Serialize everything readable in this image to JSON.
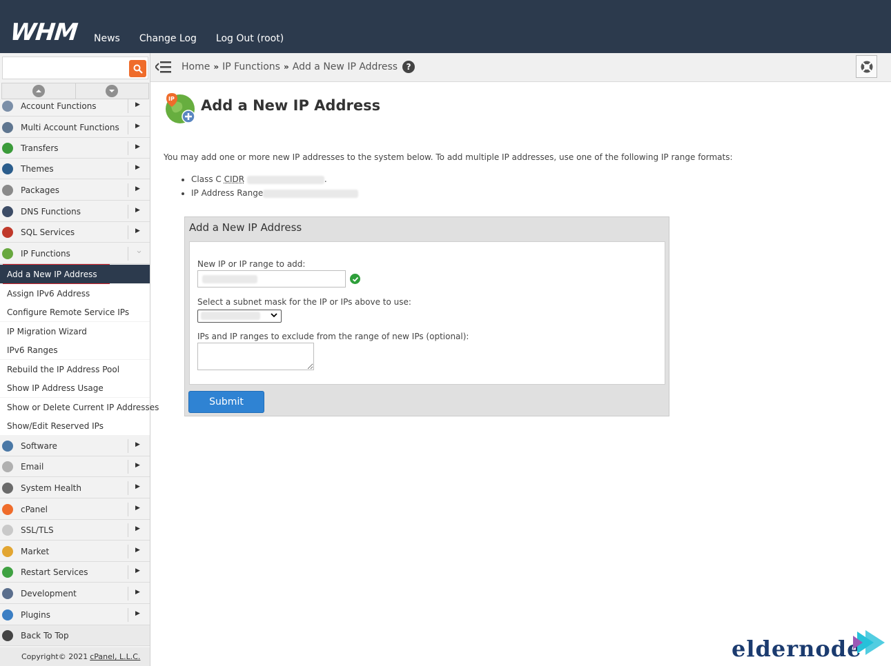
{
  "topbar": {
    "logo": "WHM",
    "nav": [
      "News",
      "Change Log",
      "Log Out (root)"
    ]
  },
  "sidebar": {
    "search_value": "",
    "items_top": [
      {
        "label": "Account Functions",
        "icon": "account-icon",
        "color": "#7b8fa8"
      },
      {
        "label": "Multi Account Functions",
        "icon": "multi-account-icon",
        "color": "#5f7690"
      },
      {
        "label": "Transfers",
        "icon": "transfers-icon",
        "color": "#3b9b3a"
      },
      {
        "label": "Themes",
        "icon": "themes-icon",
        "color": "#2b5d8c"
      },
      {
        "label": "Packages",
        "icon": "packages-icon",
        "color": "#8a8a8a"
      },
      {
        "label": "DNS Functions",
        "icon": "dns-icon",
        "color": "#3c4c66"
      },
      {
        "label": "SQL Services",
        "icon": "sql-icon",
        "color": "#c0392b"
      },
      {
        "label": "IP Functions",
        "icon": "ip-icon",
        "color": "#68a83f"
      }
    ],
    "sub_items": [
      "Add a New IP Address",
      "Assign IPv6 Address",
      "Configure Remote Service IPs",
      "IP Migration Wizard",
      "IPv6 Ranges",
      "Rebuild the IP Address Pool",
      "Show IP Address Usage",
      "Show or Delete Current IP Addresses",
      "Show/Edit Reserved IPs"
    ],
    "items_bottom": [
      {
        "label": "Software",
        "icon": "software-icon",
        "color": "#4a78a6"
      },
      {
        "label": "Email",
        "icon": "email-icon",
        "color": "#b0b0b0"
      },
      {
        "label": "System Health",
        "icon": "system-health-icon",
        "color": "#6b6b6b"
      },
      {
        "label": "cPanel",
        "icon": "cpanel-icon",
        "color": "#ef6c2b"
      },
      {
        "label": "SSL/TLS",
        "icon": "ssl-icon",
        "color": "#c9c9c9"
      },
      {
        "label": "Market",
        "icon": "market-icon",
        "color": "#e2a531"
      },
      {
        "label": "Restart Services",
        "icon": "restart-icon",
        "color": "#3fa142"
      },
      {
        "label": "Development",
        "icon": "development-icon",
        "color": "#5a6e8c"
      },
      {
        "label": "Plugins",
        "icon": "plugins-icon",
        "color": "#3b7fc4"
      },
      {
        "label": "Back To Top",
        "icon": "back-to-top-icon",
        "color": "#444444"
      }
    ],
    "footer_prefix": "Copyright© 2021",
    "footer_link": "cPanel, L.L.C."
  },
  "breadcrumb": {
    "home": "Home",
    "section": "IP Functions",
    "current": "Add a New IP Address",
    "help": "?"
  },
  "main": {
    "title": "Add a New IP Address",
    "intro": "You may add one or more new IP addresses to the system below. To add multiple IP addresses, use one of the following IP range formats:",
    "format_1_label": "Class C",
    "format_1_abbr": "CIDR",
    "format_2_label": "IP Address Range"
  },
  "form": {
    "heading": "Add a New IP Address",
    "ip_label": "New IP or IP range to add:",
    "ip_value": "",
    "subnet_label": "Select a subnet mask for the IP or IPs above to use:",
    "subnet_value": "",
    "exclude_label": "IPs and IP ranges to exclude from the range of new IPs (optional):",
    "submit_label": "Submit"
  },
  "watermark": {
    "text": "eldernode"
  },
  "colors": {
    "topbar": "#2c3a4d",
    "accent": "#ef6c2b",
    "active_outline": "#d6242b",
    "submit": "#2f83d3",
    "valid": "#2e9f3a"
  }
}
